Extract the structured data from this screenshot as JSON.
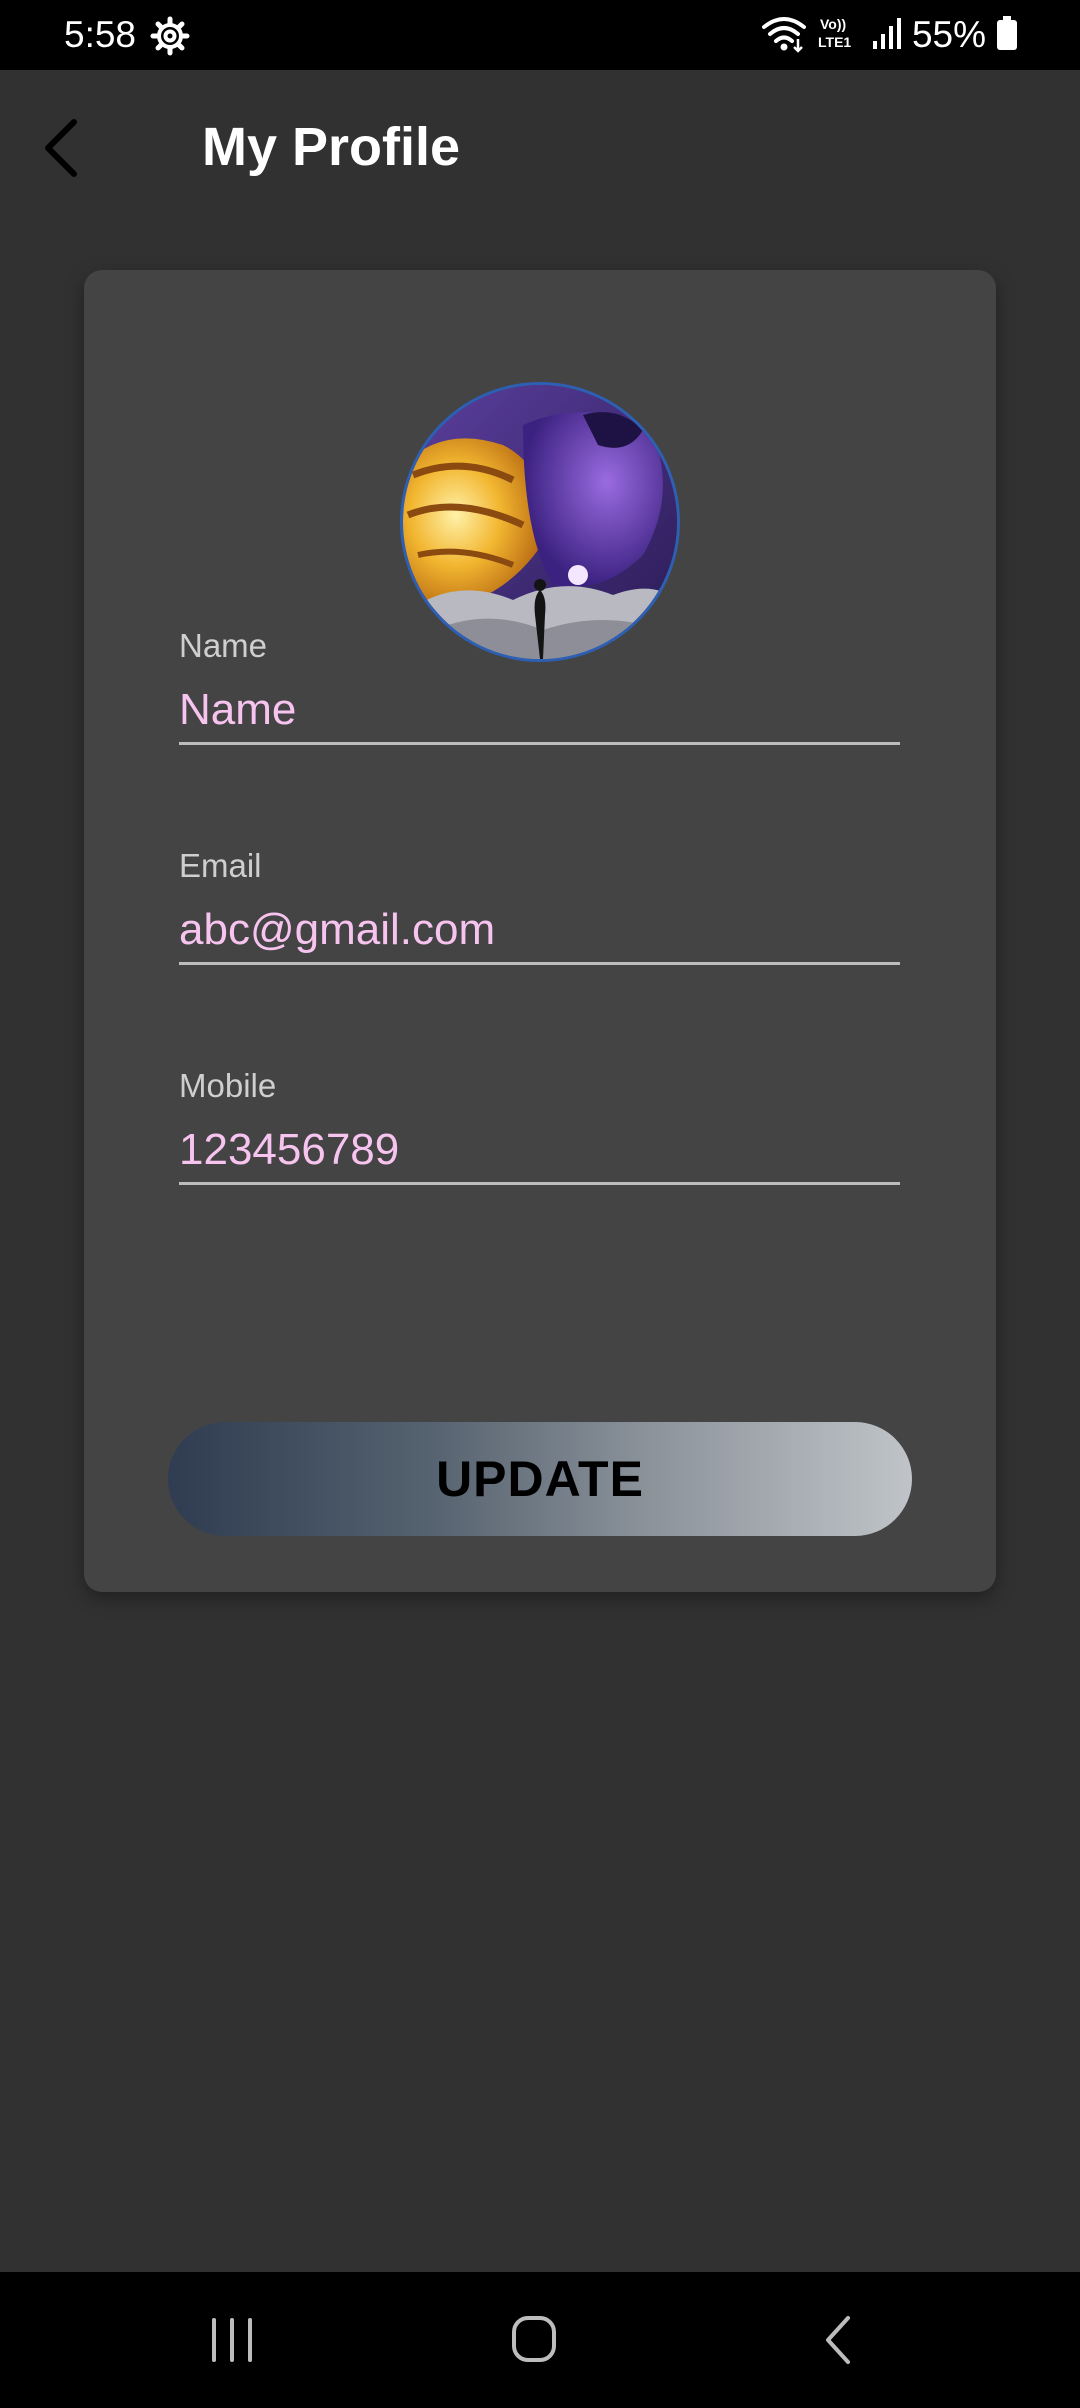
{
  "status_bar": {
    "time": "5:58",
    "network_label": "Vo)) LTE1",
    "battery_percent": "55%",
    "icons": [
      "gear-icon",
      "wifi-icon",
      "volte-icon",
      "signal-icon",
      "battery-icon"
    ]
  },
  "header": {
    "title": "My Profile",
    "back_icon": "chevron-left-icon"
  },
  "profile": {
    "avatar": "profile-avatar-image",
    "fields": {
      "name": {
        "label": "Name",
        "value": "Name"
      },
      "email": {
        "label": "Email",
        "value": "abc@gmail.com"
      },
      "mobile": {
        "label": "Mobile",
        "value": "123456789"
      }
    },
    "update_label": "UPDATE"
  },
  "nav_bar": {
    "icons": [
      "recents-icon",
      "home-icon",
      "back-icon"
    ]
  },
  "colors": {
    "background": "#313131",
    "card": "#444444",
    "field_value": "#f7c4ef",
    "button_gradient_start": "#2f3c51",
    "button_gradient_end": "#c0c4c8"
  }
}
